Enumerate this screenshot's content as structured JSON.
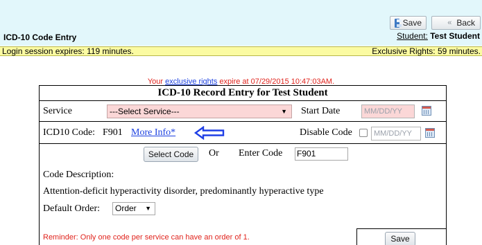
{
  "header": {
    "save_label": "Save",
    "back_label": "Back",
    "page_title": "ICD-10 Code Entry",
    "student_label": "Student:",
    "student_name": "Test Student"
  },
  "session_bar": {
    "login_expires": "Login session expires: 119 minutes.",
    "exclusive_rights": "Exclusive Rights: 59 minutes."
  },
  "rights_notice": {
    "prefix": "Your ",
    "link": "exclusive rights",
    "suffix": " expire at 07/29/2015 10:47:03AM."
  },
  "form": {
    "title": "ICD-10 Record Entry for Test Student",
    "service_label": "Service",
    "service_value": "---Select Service---",
    "start_date_label": "Start Date",
    "start_date_placeholder": "MM/DD/YY",
    "icd_label": "ICD10 Code:",
    "icd_value": "F901",
    "more_info": "More Info*",
    "disable_code_label": "Disable Code",
    "disable_date_placeholder": "MM/DD/YY",
    "select_code_button": "Select Code",
    "or_label": "Or",
    "enter_code_label": "Enter Code",
    "enter_code_value": "F901",
    "code_description_label": "Code Description:",
    "code_description": "Attention-deficit hyperactivity disorder, predominantly hyperactive type",
    "default_order_label": "Default Order:",
    "default_order_value": "Order",
    "reminder": "Reminder: Only one code per service can have an order of 1.",
    "save_button": "Save"
  },
  "colors": {
    "topbar_bg": "#e2f7fb",
    "session_bar_bg": "#fbfba2",
    "required_field_bg": "#fbd7d7",
    "link_blue": "#1a3fe0",
    "alert_red": "#e0231c"
  },
  "icons": [
    "floppy-disk-icon",
    "chevron-left-icon",
    "calendar-icon",
    "arrow-left-icon"
  ]
}
